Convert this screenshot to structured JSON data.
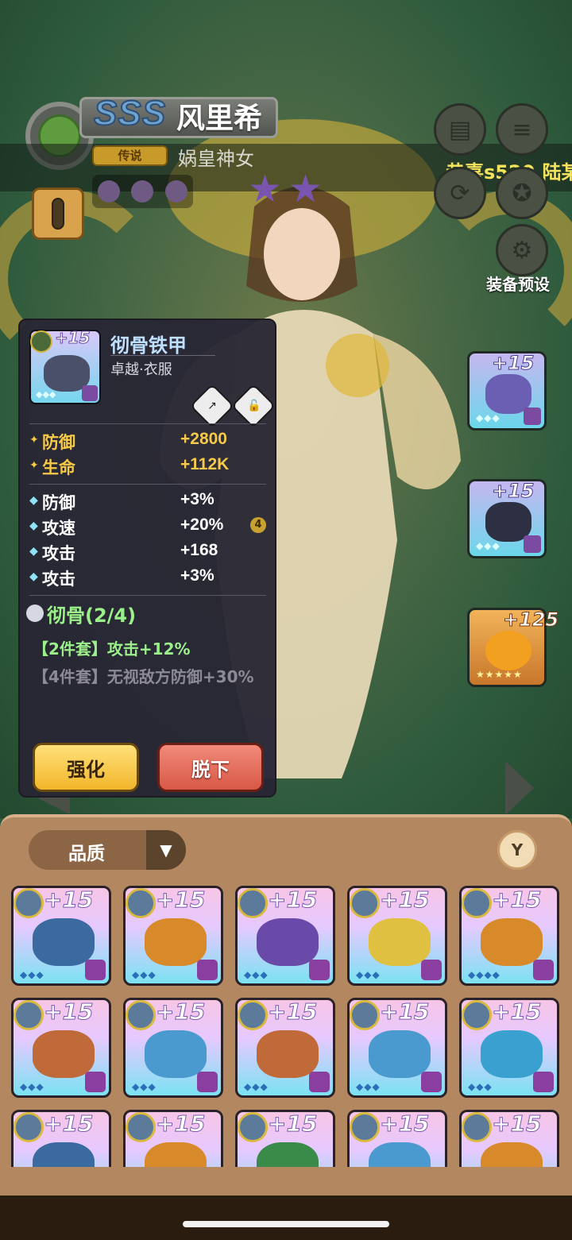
{
  "hero": {
    "rank": "SSS",
    "name": "风里希",
    "rarity": "传说",
    "title": "娲皇神女",
    "stars": 2
  },
  "marquee": "恭喜s520.陆某",
  "side_menu": {
    "preset_label": "装备预设"
  },
  "equipped_slots": [
    {
      "level": "+15",
      "gems": "◆◆◆",
      "color": "blue"
    },
    {
      "level": "+15",
      "gems": "◆◆◆",
      "color": "blue"
    },
    {
      "level": "+125",
      "gems": "★★★★★",
      "color": "orange"
    }
  ],
  "detail": {
    "thumb_level": "+15",
    "item_name": "彻骨铁甲",
    "item_category": "卓越·衣服",
    "main_stats": [
      {
        "name": "防御",
        "value": "+2800"
      },
      {
        "name": "生命",
        "value": "+112K"
      }
    ],
    "sub_stats": [
      {
        "name": "防御",
        "value": "+3%",
        "badge": ""
      },
      {
        "name": "攻速",
        "value": "+20%",
        "badge": "4"
      },
      {
        "name": "攻击",
        "value": "+168",
        "badge": ""
      },
      {
        "name": "攻击",
        "value": "+3%",
        "badge": ""
      }
    ],
    "set_name": "彻骨(2/4)",
    "set_bonus_2": "【2件套】攻击+12%",
    "set_bonus_4": "【4件套】无视敌方防御+30%",
    "enhance_label": "强化",
    "remove_label": "脱下"
  },
  "inventory": {
    "sort_label": "品质",
    "items": [
      {
        "level": "+15",
        "gems": "◆◆◆",
        "item_color": "#3a6aa0"
      },
      {
        "level": "+15",
        "gems": "◆◆◆",
        "item_color": "#d88a2a"
      },
      {
        "level": "+15",
        "gems": "◆◆◆",
        "item_color": "#6a4aa8"
      },
      {
        "level": "+15",
        "gems": "◆◆◆",
        "item_color": "#e0c040"
      },
      {
        "level": "+15",
        "gems": "◆◆◆◆",
        "item_color": "#d88a2a"
      },
      {
        "level": "+15",
        "gems": "◆◆◆",
        "item_color": "#c06a3a"
      },
      {
        "level": "+15",
        "gems": "◆◆◆",
        "item_color": "#4a9ad0"
      },
      {
        "level": "+15",
        "gems": "◆◆◆",
        "item_color": "#c06a3a"
      },
      {
        "level": "+15",
        "gems": "◆◆◆",
        "item_color": "#4a9ad0"
      },
      {
        "level": "+15",
        "gems": "◆◆◆",
        "item_color": "#3aa0d0"
      },
      {
        "level": "+15",
        "gems": "",
        "item_color": "#3a6aa0"
      },
      {
        "level": "+15",
        "gems": "",
        "item_color": "#d88a2a"
      },
      {
        "level": "+15",
        "gems": "",
        "item_color": "#3a8a4a"
      },
      {
        "level": "+15",
        "gems": "",
        "item_color": "#4a9ad0"
      },
      {
        "level": "+15",
        "gems": "",
        "item_color": "#d88a2a"
      }
    ]
  }
}
